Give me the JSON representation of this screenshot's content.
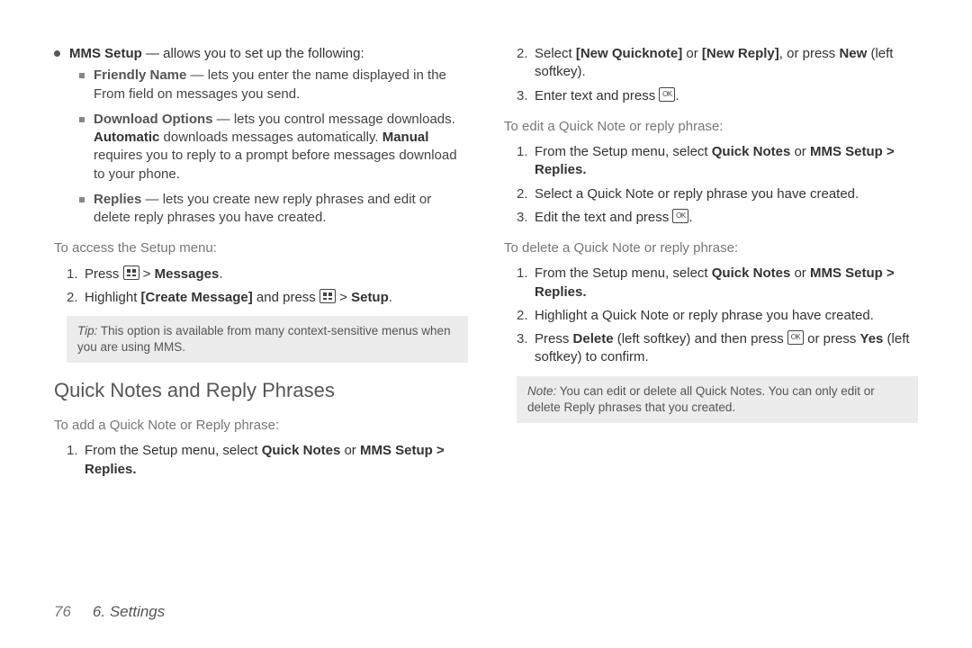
{
  "col1": {
    "mms_setup_label": "MMS Setup",
    "mms_setup_text": " — allows you to set up the following:",
    "friendly_label": "Friendly Name",
    "friendly_text": " — lets you enter the name displayed in the From field on messages you send.",
    "download_label": "Download Options",
    "download_text_a": " — lets you control message downloads. ",
    "download_auto": "Automatic",
    "download_text_b": " downloads messages automatically. ",
    "download_manual": "Manual",
    "download_text_c": " requires you to reply to a prompt before messages download to your phone.",
    "replies_label": "Replies",
    "replies_text": " — lets you create new reply phrases and edit or delete reply phrases you have created.",
    "access_lead": "To access the Setup menu:",
    "step1_a": "Press ",
    "step1_b": " > ",
    "step1_messages": "Messages",
    "step1_c": ".",
    "step2_a": "Highlight ",
    "step2_create": "[Create Message]",
    "step2_b": " and press ",
    "step2_c": " > ",
    "step2_setup": "Setup",
    "step2_d": ".",
    "tip_label": "Tip:",
    "tip_text": " This option is available from many context-sensitive menus when you are using MMS.",
    "h3": "Quick Notes and Reply Phrases",
    "add_lead": "To add a Quick Note or Reply phrase:",
    "add1_a": "From the Setup menu, select ",
    "add1_qn": "Quick Notes",
    "add1_b": " or ",
    "add1_mms": "MMS Setup > Replies.",
    "n1": "1.",
    "n2": "2."
  },
  "col2": {
    "s2_a": "Select ",
    "s2_nq": "[New Quicknote]",
    "s2_b": " or ",
    "s2_nr": "[New Reply]",
    "s2_c": ", or press ",
    "s2_new": "New",
    "s2_d": " (left softkey).",
    "s3_a": "Enter text and press ",
    "s3_b": ".",
    "edit_lead": "To edit a Quick Note or reply phrase:",
    "e1_a": "From the Setup menu, select ",
    "e1_qn": "Quick Notes",
    "e1_b": " or ",
    "e1_mms": "MMS Setup > Replies.",
    "e2": "Select a Quick Note or reply phrase you have created.",
    "e3_a": "Edit the text and press ",
    "e3_b": ".",
    "del_lead": "To delete a Quick Note or reply phrase:",
    "d1_a": "From the Setup menu, select ",
    "d1_qn": "Quick Notes",
    "d1_b": " or ",
    "d1_mms": "MMS Setup > Replies.",
    "d2": "Highlight a Quick Note or reply phrase you have created.",
    "d3_a": "Press ",
    "d3_del": "Delete",
    "d3_b": " (left softkey) and then press ",
    "d3_c": " or press ",
    "d3_yes": "Yes",
    "d3_d": " (left softkey) to confirm.",
    "note_label": "Note:",
    "note_text": " You can edit or delete all Quick Notes. You can only edit or delete Reply phrases that you created.",
    "n1": "1.",
    "n2": "2.",
    "n3": "3."
  },
  "footer": {
    "page": "76",
    "chapter": "6. Settings"
  }
}
